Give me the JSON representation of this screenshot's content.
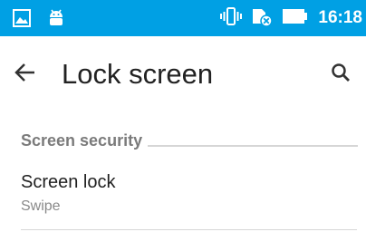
{
  "status_bar": {
    "time": "16:18",
    "background": "#00a0e4",
    "icons_left": [
      "image-notification-icon",
      "android-notification-icon"
    ],
    "icons_right": [
      "vibrate-icon",
      "no-sim-icon",
      "battery-icon"
    ]
  },
  "toolbar": {
    "title": "Lock screen",
    "back_icon": "arrow-back-icon",
    "search_icon": "search-icon"
  },
  "section": {
    "title": "Screen security"
  },
  "items": [
    {
      "title": "Screen lock",
      "summary": "Swipe"
    }
  ]
}
